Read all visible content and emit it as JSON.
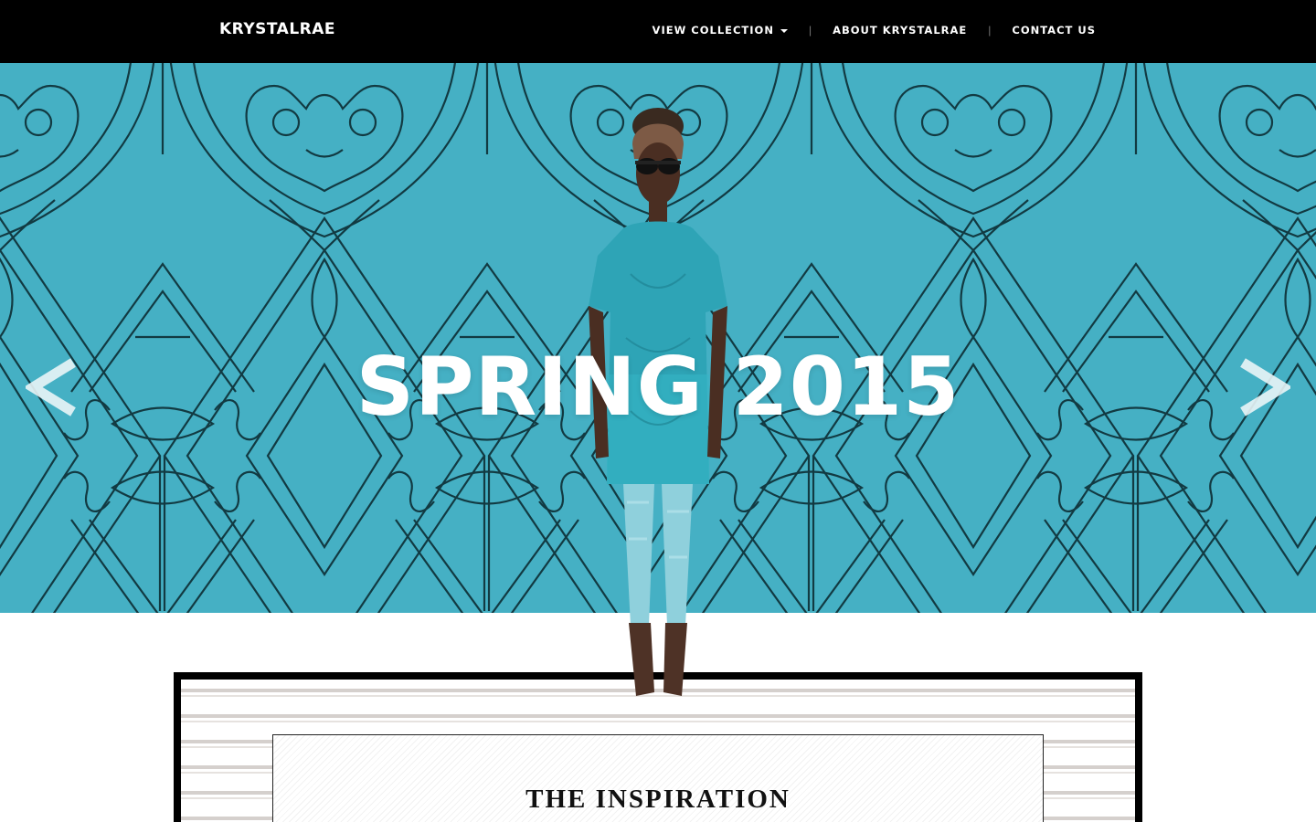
{
  "nav": {
    "brand": "KRYSTALRAE",
    "links": [
      {
        "label": "VIEW COLLECTION",
        "has_dropdown": true
      },
      {
        "label": "ABOUT KRYSTALRAE"
      },
      {
        "label": "CONTACT US"
      }
    ],
    "separator": "|"
  },
  "hero": {
    "title": "SPRING 2015",
    "prev_icon": "chevron-left-icon",
    "next_icon": "chevron-right-icon",
    "background_color": "#45b0c4",
    "pattern_color": "#123a42"
  },
  "section": {
    "title": "THE INSPIRATION"
  }
}
